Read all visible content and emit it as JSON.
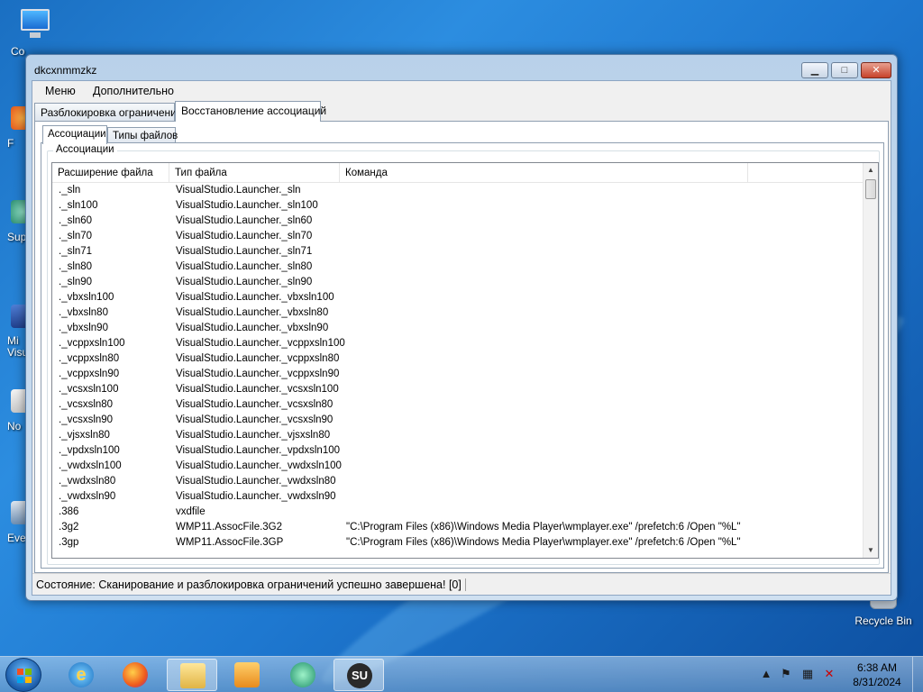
{
  "desktop": {
    "computer_label": "Co",
    "side_labels": [
      "F",
      "Sup",
      "Mi\nVisu",
      "No",
      "Eve"
    ],
    "recycle_bin_label": "Recycle Bin"
  },
  "window": {
    "title": "dkcxnmmzkz",
    "min_glyph": "▁",
    "max_glyph": "□",
    "close_glyph": "✕",
    "menu": [
      "Меню",
      "Дополнительно"
    ],
    "tabs": [
      "Разблокировка ограничений",
      "Восстановление ассоциаций"
    ],
    "active_tab_index": 1,
    "inner_tabs": [
      "Ассоциации",
      "Типы файлов"
    ],
    "active_inner_tab_index": 0,
    "group_title": "Ассоциации",
    "columns": [
      "Расширение файла",
      "Тип файла",
      "Команда"
    ],
    "rows": [
      {
        "ext": "._sln",
        "type": "VisualStudio.Launcher._sln",
        "cmd": ""
      },
      {
        "ext": "._sln100",
        "type": "VisualStudio.Launcher._sln100",
        "cmd": ""
      },
      {
        "ext": "._sln60",
        "type": "VisualStudio.Launcher._sln60",
        "cmd": ""
      },
      {
        "ext": "._sln70",
        "type": "VisualStudio.Launcher._sln70",
        "cmd": ""
      },
      {
        "ext": "._sln71",
        "type": "VisualStudio.Launcher._sln71",
        "cmd": ""
      },
      {
        "ext": "._sln80",
        "type": "VisualStudio.Launcher._sln80",
        "cmd": ""
      },
      {
        "ext": "._sln90",
        "type": "VisualStudio.Launcher._sln90",
        "cmd": ""
      },
      {
        "ext": "._vbxsln100",
        "type": "VisualStudio.Launcher._vbxsln100",
        "cmd": ""
      },
      {
        "ext": "._vbxsln80",
        "type": "VisualStudio.Launcher._vbxsln80",
        "cmd": ""
      },
      {
        "ext": "._vbxsln90",
        "type": "VisualStudio.Launcher._vbxsln90",
        "cmd": ""
      },
      {
        "ext": "._vcppxsln100",
        "type": "VisualStudio.Launcher._vcppxsln100",
        "cmd": ""
      },
      {
        "ext": "._vcppxsln80",
        "type": "VisualStudio.Launcher._vcppxsln80",
        "cmd": ""
      },
      {
        "ext": "._vcppxsln90",
        "type": "VisualStudio.Launcher._vcppxsln90",
        "cmd": ""
      },
      {
        "ext": "._vcsxsln100",
        "type": "VisualStudio.Launcher._vcsxsln100",
        "cmd": ""
      },
      {
        "ext": "._vcsxsln80",
        "type": "VisualStudio.Launcher._vcsxsln80",
        "cmd": ""
      },
      {
        "ext": "._vcsxsln90",
        "type": "VisualStudio.Launcher._vcsxsln90",
        "cmd": ""
      },
      {
        "ext": "._vjsxsln80",
        "type": "VisualStudio.Launcher._vjsxsln80",
        "cmd": ""
      },
      {
        "ext": "._vpdxsln100",
        "type": "VisualStudio.Launcher._vpdxsln100",
        "cmd": ""
      },
      {
        "ext": "._vwdxsln100",
        "type": "VisualStudio.Launcher._vwdxsln100",
        "cmd": ""
      },
      {
        "ext": "._vwdxsln80",
        "type": "VisualStudio.Launcher._vwdxsln80",
        "cmd": ""
      },
      {
        "ext": "._vwdxsln90",
        "type": "VisualStudio.Launcher._vwdxsln90",
        "cmd": ""
      },
      {
        "ext": ".386",
        "type": "vxdfile",
        "cmd": ""
      },
      {
        "ext": ".3g2",
        "type": "WMP11.AssocFile.3G2",
        "cmd": "\"C:\\Program Files (x86)\\Windows Media Player\\wmplayer.exe\" /prefetch:6 /Open \"%L\""
      },
      {
        "ext": ".3gp",
        "type": "WMP11.AssocFile.3GP",
        "cmd": "\"C:\\Program Files (x86)\\Windows Media Player\\wmplayer.exe\" /prefetch:6 /Open \"%L\""
      }
    ],
    "status": "Состояние: Сканирование и разблокировка ограничений успешно завершена! [0]"
  },
  "taskbar": {
    "clock_time": "6:38 AM",
    "clock_date": "8/31/2024",
    "apps": [
      "internet-explorer",
      "firefox",
      "file-explorer",
      "media-player",
      "edge-like",
      "su-app"
    ]
  }
}
